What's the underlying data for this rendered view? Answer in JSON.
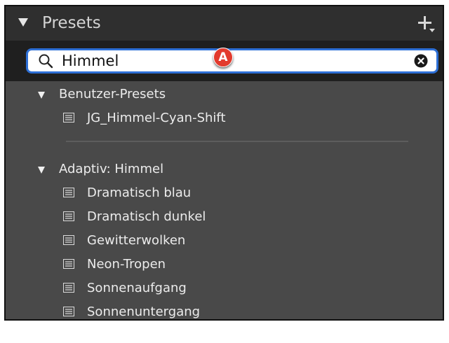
{
  "panel": {
    "title": "Presets",
    "add_icon": "plus-dropdown-icon"
  },
  "search": {
    "value": "Himmel",
    "icon": "search-icon",
    "clear_icon": "clear-circle-x-icon",
    "border_color": "#2d6fd6"
  },
  "annotation": {
    "marker_label": "A",
    "color": "#e23a2d"
  },
  "groups": [
    {
      "label": "Benutzer-Presets",
      "items": [
        {
          "label": "JG_Himmel-Cyan-Shift",
          "icon": "preset-list-icon"
        }
      ]
    },
    {
      "label": "Adaptiv: Himmel",
      "items": [
        {
          "label": "Dramatisch blau",
          "icon": "preset-list-icon"
        },
        {
          "label": "Dramatisch dunkel",
          "icon": "preset-list-icon"
        },
        {
          "label": "Gewitterwolken",
          "icon": "preset-list-icon"
        },
        {
          "label": "Neon-Tropen",
          "icon": "preset-list-icon"
        },
        {
          "label": "Sonnenaufgang",
          "icon": "preset-list-icon"
        },
        {
          "label": "Sonnenuntergang",
          "icon": "preset-list-icon"
        }
      ]
    }
  ]
}
